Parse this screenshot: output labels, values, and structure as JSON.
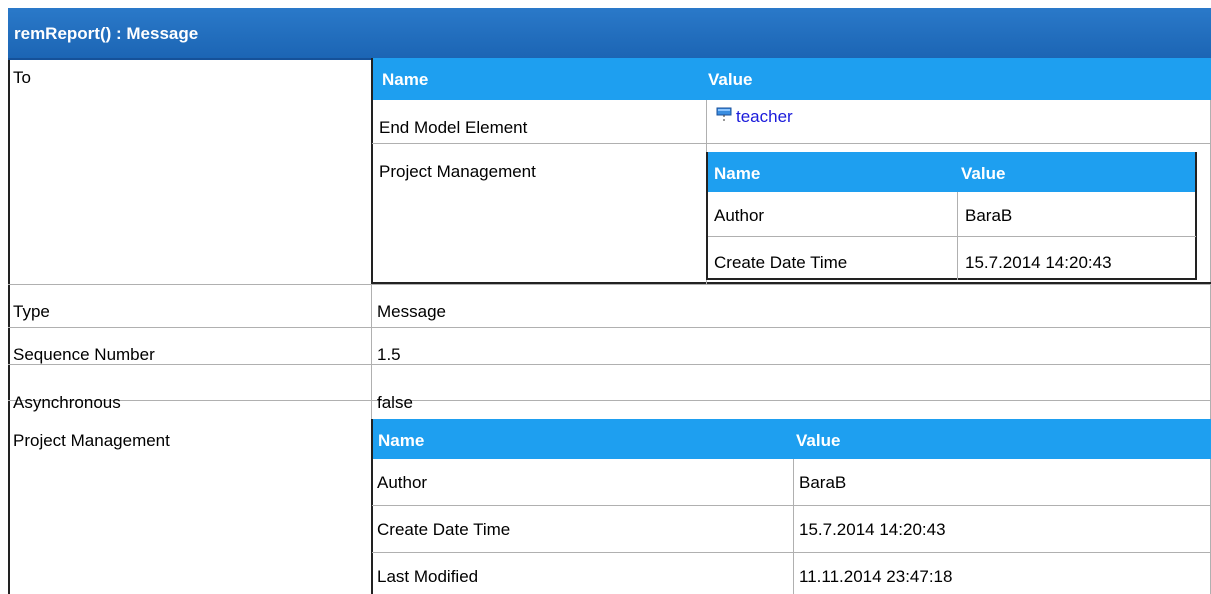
{
  "title": "remReport() : Message",
  "rows": {
    "to_label": "To",
    "type_label": "Type",
    "type_value": "Message",
    "seq_label": "Sequence Number",
    "seq_value": "1.5",
    "async_label": "Asynchronous",
    "async_value": "false",
    "pm_label": "Project Management"
  },
  "to_table": {
    "col_name": "Name",
    "col_value": "Value",
    "end_label": "End Model Element",
    "end_value": "teacher",
    "end_icon": "lifeline-icon",
    "pm_label": "Project Management",
    "pm": {
      "col_name": "Name",
      "col_value": "Value",
      "author_label": "Author",
      "author_value": "BaraB",
      "create_label": "Create Date Time",
      "create_value": "15.7.2014 14:20:43"
    }
  },
  "pm_table": {
    "col_name": "Name",
    "col_value": "Value",
    "author_label": "Author",
    "author_value": "BaraB",
    "create_label": "Create Date Time",
    "create_value": "15.7.2014 14:20:43",
    "modified_label": "Last Modified",
    "modified_value": "11.11.2014 23:47:18"
  },
  "colors": {
    "title_bg": "#1c65b4",
    "header_bg": "#1e9ff0",
    "link": "#1a1adb"
  }
}
